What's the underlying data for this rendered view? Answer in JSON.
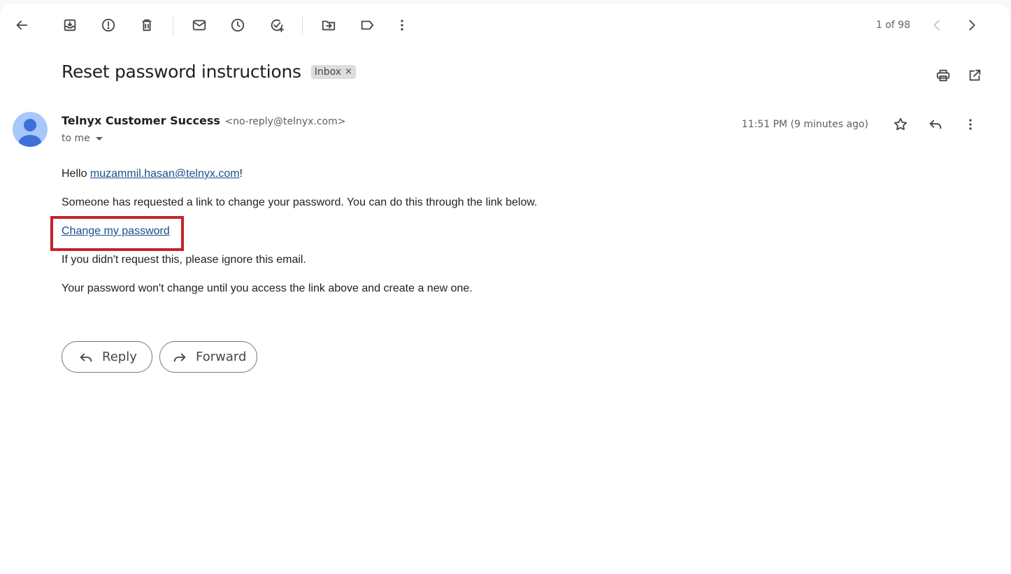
{
  "toolbar": {
    "pager_text": "1 of 98"
  },
  "message": {
    "subject": "Reset password instructions",
    "label": "Inbox",
    "label_remove": "×",
    "sender_name": "Telnyx Customer Success",
    "sender_email": "<no-reply@telnyx.com>",
    "recipient": "to me",
    "timestamp": "11:51 PM (9 minutes ago)"
  },
  "body": {
    "greeting_prefix": "Hello ",
    "greeting_email": "muzammil.hasan@telnyx.com",
    "greeting_suffix": "!",
    "line1": "Someone has requested a link to change your password. You can do this through the link below.",
    "link_text": "Change my password",
    "line2": "If you didn't request this, please ignore this email.",
    "line3": "Your password won't change until you access the link above and create a new one."
  },
  "actions": {
    "reply_label": "Reply",
    "forward_label": "Forward"
  },
  "colors": {
    "link": "#1a4f8b",
    "highlight": "#c5222b",
    "avatar_bg": "#a8c7fa",
    "avatar_fg": "#3f6fd8"
  }
}
